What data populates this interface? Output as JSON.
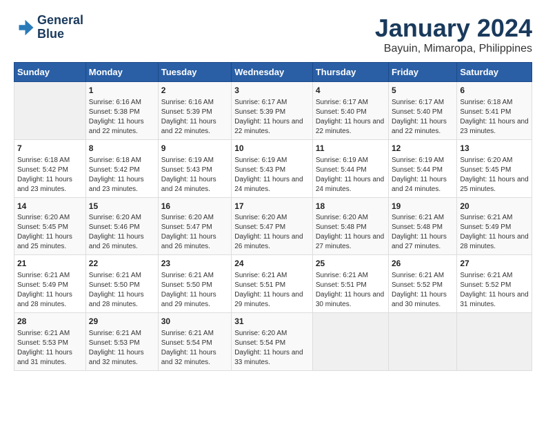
{
  "logo": {
    "line1": "General",
    "line2": "Blue"
  },
  "title": "January 2024",
  "subtitle": "Bayuin, Mimaropa, Philippines",
  "headers": [
    "Sunday",
    "Monday",
    "Tuesday",
    "Wednesday",
    "Thursday",
    "Friday",
    "Saturday"
  ],
  "weeks": [
    [
      {
        "day": "",
        "sunrise": "",
        "sunset": "",
        "daylight": ""
      },
      {
        "day": "1",
        "sunrise": "Sunrise: 6:16 AM",
        "sunset": "Sunset: 5:38 PM",
        "daylight": "Daylight: 11 hours and 22 minutes."
      },
      {
        "day": "2",
        "sunrise": "Sunrise: 6:16 AM",
        "sunset": "Sunset: 5:39 PM",
        "daylight": "Daylight: 11 hours and 22 minutes."
      },
      {
        "day": "3",
        "sunrise": "Sunrise: 6:17 AM",
        "sunset": "Sunset: 5:39 PM",
        "daylight": "Daylight: 11 hours and 22 minutes."
      },
      {
        "day": "4",
        "sunrise": "Sunrise: 6:17 AM",
        "sunset": "Sunset: 5:40 PM",
        "daylight": "Daylight: 11 hours and 22 minutes."
      },
      {
        "day": "5",
        "sunrise": "Sunrise: 6:17 AM",
        "sunset": "Sunset: 5:40 PM",
        "daylight": "Daylight: 11 hours and 22 minutes."
      },
      {
        "day": "6",
        "sunrise": "Sunrise: 6:18 AM",
        "sunset": "Sunset: 5:41 PM",
        "daylight": "Daylight: 11 hours and 23 minutes."
      }
    ],
    [
      {
        "day": "7",
        "sunrise": "Sunrise: 6:18 AM",
        "sunset": "Sunset: 5:42 PM",
        "daylight": "Daylight: 11 hours and 23 minutes."
      },
      {
        "day": "8",
        "sunrise": "Sunrise: 6:18 AM",
        "sunset": "Sunset: 5:42 PM",
        "daylight": "Daylight: 11 hours and 23 minutes."
      },
      {
        "day": "9",
        "sunrise": "Sunrise: 6:19 AM",
        "sunset": "Sunset: 5:43 PM",
        "daylight": "Daylight: 11 hours and 24 minutes."
      },
      {
        "day": "10",
        "sunrise": "Sunrise: 6:19 AM",
        "sunset": "Sunset: 5:43 PM",
        "daylight": "Daylight: 11 hours and 24 minutes."
      },
      {
        "day": "11",
        "sunrise": "Sunrise: 6:19 AM",
        "sunset": "Sunset: 5:44 PM",
        "daylight": "Daylight: 11 hours and 24 minutes."
      },
      {
        "day": "12",
        "sunrise": "Sunrise: 6:19 AM",
        "sunset": "Sunset: 5:44 PM",
        "daylight": "Daylight: 11 hours and 24 minutes."
      },
      {
        "day": "13",
        "sunrise": "Sunrise: 6:20 AM",
        "sunset": "Sunset: 5:45 PM",
        "daylight": "Daylight: 11 hours and 25 minutes."
      }
    ],
    [
      {
        "day": "14",
        "sunrise": "Sunrise: 6:20 AM",
        "sunset": "Sunset: 5:45 PM",
        "daylight": "Daylight: 11 hours and 25 minutes."
      },
      {
        "day": "15",
        "sunrise": "Sunrise: 6:20 AM",
        "sunset": "Sunset: 5:46 PM",
        "daylight": "Daylight: 11 hours and 26 minutes."
      },
      {
        "day": "16",
        "sunrise": "Sunrise: 6:20 AM",
        "sunset": "Sunset: 5:47 PM",
        "daylight": "Daylight: 11 hours and 26 minutes."
      },
      {
        "day": "17",
        "sunrise": "Sunrise: 6:20 AM",
        "sunset": "Sunset: 5:47 PM",
        "daylight": "Daylight: 11 hours and 26 minutes."
      },
      {
        "day": "18",
        "sunrise": "Sunrise: 6:20 AM",
        "sunset": "Sunset: 5:48 PM",
        "daylight": "Daylight: 11 hours and 27 minutes."
      },
      {
        "day": "19",
        "sunrise": "Sunrise: 6:21 AM",
        "sunset": "Sunset: 5:48 PM",
        "daylight": "Daylight: 11 hours and 27 minutes."
      },
      {
        "day": "20",
        "sunrise": "Sunrise: 6:21 AM",
        "sunset": "Sunset: 5:49 PM",
        "daylight": "Daylight: 11 hours and 28 minutes."
      }
    ],
    [
      {
        "day": "21",
        "sunrise": "Sunrise: 6:21 AM",
        "sunset": "Sunset: 5:49 PM",
        "daylight": "Daylight: 11 hours and 28 minutes."
      },
      {
        "day": "22",
        "sunrise": "Sunrise: 6:21 AM",
        "sunset": "Sunset: 5:50 PM",
        "daylight": "Daylight: 11 hours and 28 minutes."
      },
      {
        "day": "23",
        "sunrise": "Sunrise: 6:21 AM",
        "sunset": "Sunset: 5:50 PM",
        "daylight": "Daylight: 11 hours and 29 minutes."
      },
      {
        "day": "24",
        "sunrise": "Sunrise: 6:21 AM",
        "sunset": "Sunset: 5:51 PM",
        "daylight": "Daylight: 11 hours and 29 minutes."
      },
      {
        "day": "25",
        "sunrise": "Sunrise: 6:21 AM",
        "sunset": "Sunset: 5:51 PM",
        "daylight": "Daylight: 11 hours and 30 minutes."
      },
      {
        "day": "26",
        "sunrise": "Sunrise: 6:21 AM",
        "sunset": "Sunset: 5:52 PM",
        "daylight": "Daylight: 11 hours and 30 minutes."
      },
      {
        "day": "27",
        "sunrise": "Sunrise: 6:21 AM",
        "sunset": "Sunset: 5:52 PM",
        "daylight": "Daylight: 11 hours and 31 minutes."
      }
    ],
    [
      {
        "day": "28",
        "sunrise": "Sunrise: 6:21 AM",
        "sunset": "Sunset: 5:53 PM",
        "daylight": "Daylight: 11 hours and 31 minutes."
      },
      {
        "day": "29",
        "sunrise": "Sunrise: 6:21 AM",
        "sunset": "Sunset: 5:53 PM",
        "daylight": "Daylight: 11 hours and 32 minutes."
      },
      {
        "day": "30",
        "sunrise": "Sunrise: 6:21 AM",
        "sunset": "Sunset: 5:54 PM",
        "daylight": "Daylight: 11 hours and 32 minutes."
      },
      {
        "day": "31",
        "sunrise": "Sunrise: 6:20 AM",
        "sunset": "Sunset: 5:54 PM",
        "daylight": "Daylight: 11 hours and 33 minutes."
      },
      {
        "day": "",
        "sunrise": "",
        "sunset": "",
        "daylight": ""
      },
      {
        "day": "",
        "sunrise": "",
        "sunset": "",
        "daylight": ""
      },
      {
        "day": "",
        "sunrise": "",
        "sunset": "",
        "daylight": ""
      }
    ]
  ]
}
